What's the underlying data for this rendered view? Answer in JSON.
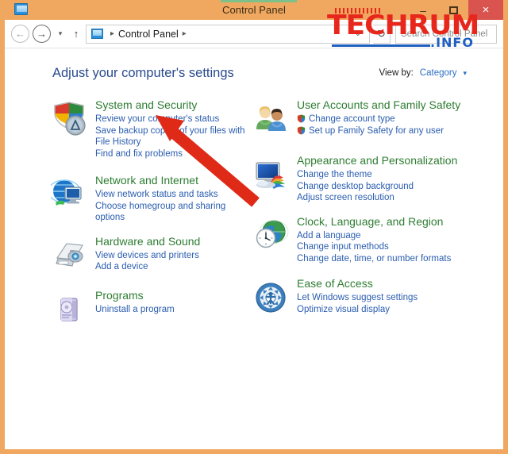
{
  "window": {
    "title": "Control Panel",
    "icon": "control-panel-icon",
    "accent_color": "#f0a860",
    "close_color": "#d9534f",
    "caption": {
      "minimize": "–",
      "maximize": "❐",
      "close": "×"
    }
  },
  "toolbar": {
    "back": "←",
    "forward": "→",
    "recent_caret": "▾",
    "up": "↑",
    "refresh": "↻",
    "breadcrumb": {
      "separator": "▸",
      "items": [
        "Control Panel"
      ],
      "dropdown_caret": "⌄"
    },
    "search": {
      "placeholder": "Search Control Panel",
      "value": ""
    }
  },
  "content": {
    "heading": "Adjust your computer's settings",
    "view_by": {
      "label": "View by:",
      "value": "Category",
      "caret": "▾"
    },
    "left_column": [
      {
        "icon": "system-and-security-icon",
        "title": "System and Security",
        "links": [
          {
            "text": "Review your computer's status",
            "shield": false
          },
          {
            "text": "Save backup copies of your files with File History",
            "shield": false
          },
          {
            "text": "Find and fix problems",
            "shield": false
          }
        ]
      },
      {
        "icon": "network-and-internet-icon",
        "title": "Network and Internet",
        "links": [
          {
            "text": "View network status and tasks",
            "shield": false
          },
          {
            "text": "Choose homegroup and sharing options",
            "shield": false
          }
        ]
      },
      {
        "icon": "hardware-and-sound-icon",
        "title": "Hardware and Sound",
        "links": [
          {
            "text": "View devices and printers",
            "shield": false
          },
          {
            "text": "Add a device",
            "shield": false
          }
        ]
      },
      {
        "icon": "programs-icon",
        "title": "Programs",
        "links": [
          {
            "text": "Uninstall a program",
            "shield": false
          }
        ]
      }
    ],
    "right_column": [
      {
        "icon": "user-accounts-icon",
        "title": "User Accounts and Family Safety",
        "links": [
          {
            "text": "Change account type",
            "shield": true
          },
          {
            "text": "Set up Family Safety for any user",
            "shield": true
          }
        ]
      },
      {
        "icon": "appearance-icon",
        "title": "Appearance and Personalization",
        "links": [
          {
            "text": "Change the theme",
            "shield": false
          },
          {
            "text": "Change desktop background",
            "shield": false
          },
          {
            "text": "Adjust screen resolution",
            "shield": false
          }
        ]
      },
      {
        "icon": "clock-language-region-icon",
        "title": "Clock, Language, and Region",
        "links": [
          {
            "text": "Add a language",
            "shield": false
          },
          {
            "text": "Change input methods",
            "shield": false
          },
          {
            "text": "Change date, time, or number formats",
            "shield": false
          }
        ]
      },
      {
        "icon": "ease-of-access-icon",
        "title": "Ease of Access",
        "links": [
          {
            "text": "Let Windows suggest settings",
            "shield": false
          },
          {
            "text": "Optimize visual display",
            "shield": false
          }
        ]
      }
    ]
  },
  "annotation": {
    "arrow_color": "#e02a18",
    "points_at": "System and Security"
  },
  "watermark": {
    "primary": "TECHRUM",
    "secondary": ".INFO",
    "primary_color": "#e8271c",
    "secondary_color": "#1f5fc0"
  }
}
